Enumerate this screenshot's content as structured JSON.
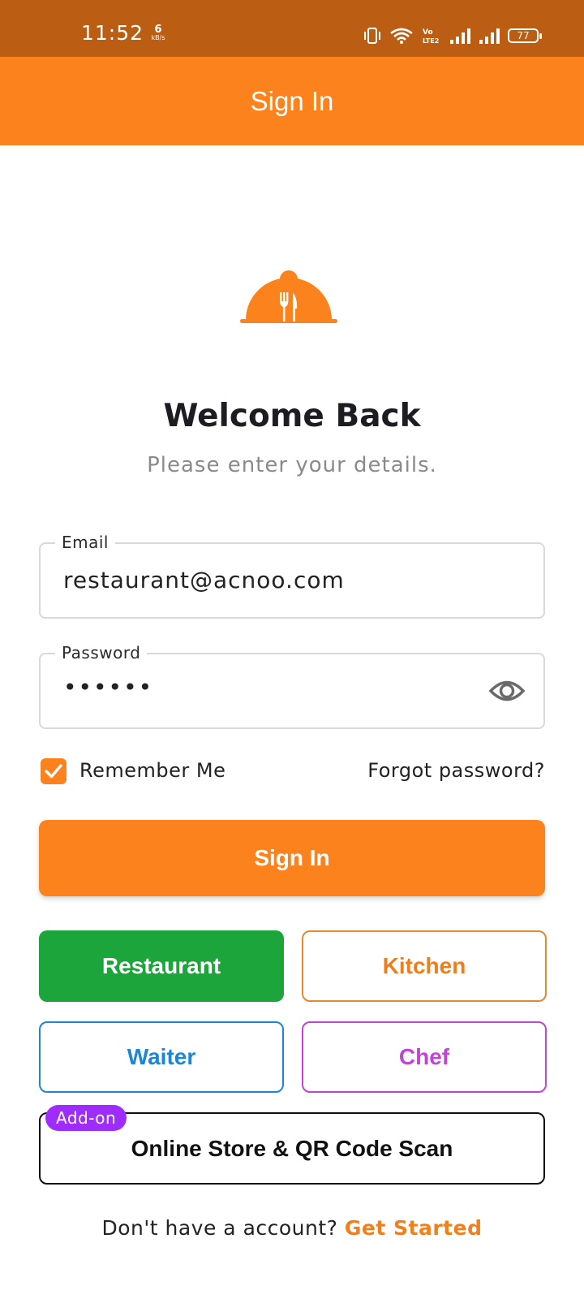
{
  "status_bar": {
    "time": "11:52",
    "net_speed_value": "6",
    "net_speed_unit": "kB/s",
    "volte_label": "Vo\nLTE2",
    "battery_level": "77"
  },
  "app_bar": {
    "title": "Sign In"
  },
  "logo": {
    "icon": "cloche-fork-knife-icon",
    "color": "#fc821d"
  },
  "welcome": {
    "title": "Welcome Back",
    "subtitle": "Please enter your details."
  },
  "form": {
    "email_label": "Email",
    "email_value": "restaurant@acnoo.com",
    "password_label": "Password",
    "password_masked": "••••••",
    "remember_label": "Remember Me",
    "remember_checked": true,
    "forgot_label": "Forgot password?",
    "submit_label": "Sign In"
  },
  "roles": [
    {
      "label": "Restaurant",
      "color": "#1ba53b",
      "selected": true
    },
    {
      "label": "Kitchen",
      "color": "#f07d1c",
      "selected": false
    },
    {
      "label": "Waiter",
      "color": "#1c86d6",
      "selected": false
    },
    {
      "label": "Chef",
      "color": "#c044d6",
      "selected": false
    }
  ],
  "addon": {
    "badge": "Add-on",
    "badge_color": "#9e2cff",
    "label": "Online Store & QR Code Scan"
  },
  "signup": {
    "prompt": "Don't have a account?",
    "link": "Get Started"
  },
  "colors": {
    "accent": "#fc821d",
    "status_bar": "#bb5e14"
  }
}
